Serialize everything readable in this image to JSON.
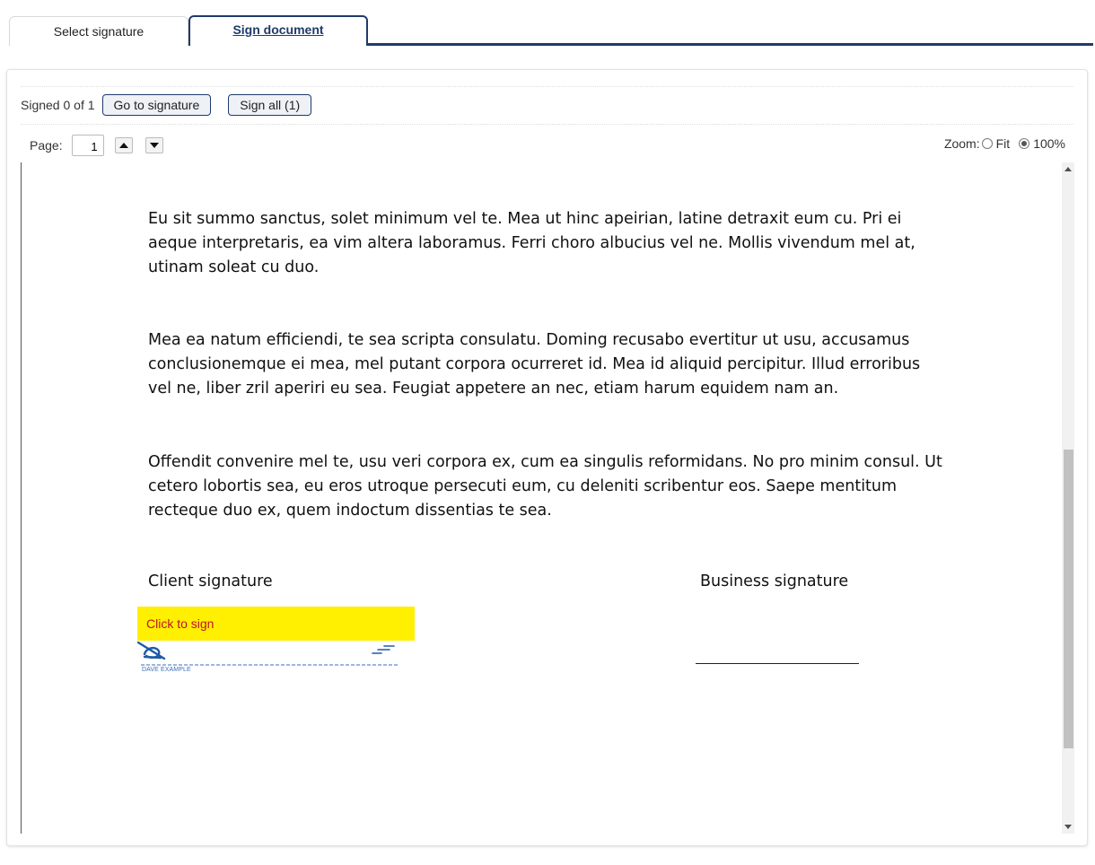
{
  "tabs": [
    {
      "label": "Select signature",
      "active": false
    },
    {
      "label": "Sign document",
      "active": true
    }
  ],
  "toolbar": {
    "status": "Signed 0 of 1",
    "goto_label": "Go to signature",
    "sign_all_label": "Sign all (1)"
  },
  "pager": {
    "label": "Page:",
    "value": "1",
    "up_icon": "triangle-up-icon",
    "down_icon": "triangle-down-icon"
  },
  "zoom": {
    "label": "Zoom:",
    "options": [
      {
        "label": "Fit",
        "checked": false
      },
      {
        "label": "100%",
        "checked": true
      }
    ]
  },
  "document": {
    "paragraphs": [
      "Eu sit summo sanctus, solet minimum vel te. Mea ut hinc apeirian, latine detraxit eum cu. Pri ei aeque interpretaris, ea vim altera laboramus. Ferri choro albucius vel ne. Mollis vivendum mel at, utinam soleat cu duo.",
      "Mea ea natum efficiendi, te sea scripta consulatu. Doming recusabo evertitur ut usu, accusamus conclusionemque ei mea, mel putant corpora ocurreret id. Mea id aliquid percipitur. Illud erroribus vel ne, liber zril aperiri eu sea. Feugiat appetere an nec, etiam harum equidem nam an.",
      "Offendit convenire mel te, usu veri corpora ex, cum ea singulis reformidans. No pro minim consul. Ut cetero lobortis sea, eu eros utroque persecuti eum, cu deleniti scribentur eos. Saepe mentitum recteque duo ex, quem indoctum dissentias te sea."
    ],
    "client_signature_label": "Client signature",
    "business_signature_label": "Business signature",
    "click_to_sign": "Click to sign",
    "signer_name": "DAVE EXAMPLE"
  },
  "colors": {
    "accent": "#1f3b6b",
    "sign_highlight": "#ffef00",
    "sign_text": "#c0102a",
    "signature_ink": "#1f5aa6"
  }
}
